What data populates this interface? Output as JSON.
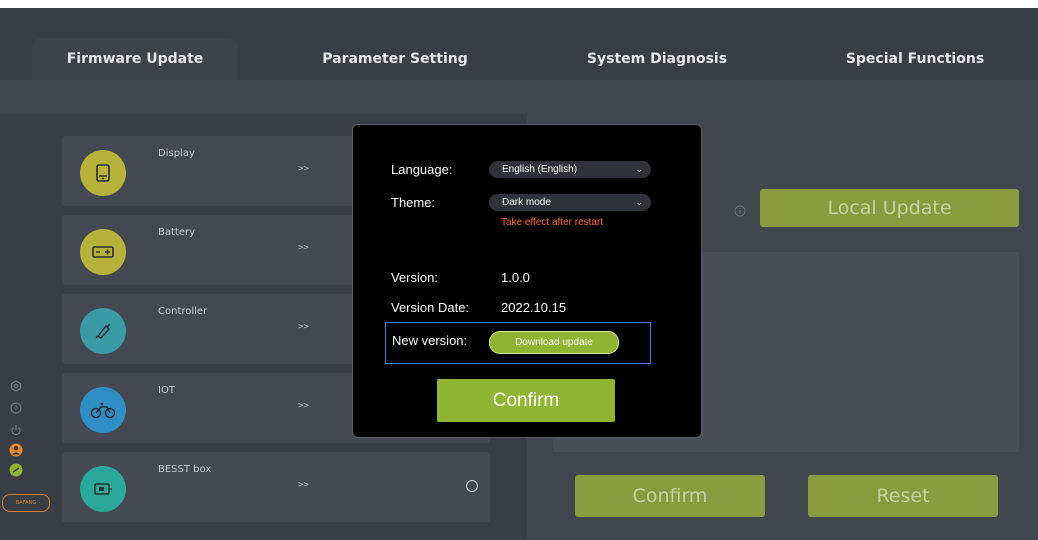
{
  "tabs": [
    {
      "label": "Firmware Update"
    },
    {
      "label": "Parameter Setting"
    },
    {
      "label": "System Diagnosis"
    },
    {
      "label": "Special Functions"
    }
  ],
  "devices": [
    {
      "name": "Display",
      "arrow": ">>",
      "color": "#b6b23a",
      "icon": "display-icon"
    },
    {
      "name": "Battery",
      "arrow": ">>",
      "color": "#b6b23a",
      "icon": "battery-icon"
    },
    {
      "name": "Controller",
      "arrow": ">>",
      "color": "#3a9aa6",
      "icon": "controller-icon"
    },
    {
      "name": "IOT",
      "arrow": ">>",
      "color": "#2f8fc4",
      "icon": "bike-icon"
    },
    {
      "name": "BESST box",
      "arrow": ">>",
      "color": "#2aa99a",
      "icon": "besst-box-icon"
    }
  ],
  "right": {
    "local_update": "Local Update",
    "confirm": "Confirm",
    "reset": "Reset"
  },
  "rail": {
    "logo": "BAFANG"
  },
  "modal": {
    "language_label": "Language:",
    "language_value": "English (English)",
    "theme_label": "Theme:",
    "theme_value": "Dark mode",
    "theme_hint": "Take effect after restart",
    "version_label": "Version:",
    "version_value": "1.0.0",
    "version_date_label": "Version Date:",
    "version_date_value": "2022.10.15",
    "new_version_label": "New version:",
    "download_button": "Download update",
    "confirm_button": "Confirm"
  },
  "colors": {
    "accent_green": "#8fb532",
    "muted_green": "#8a9a3e",
    "warning": "#ff6a3d",
    "focus_blue": "#3a7de8"
  }
}
